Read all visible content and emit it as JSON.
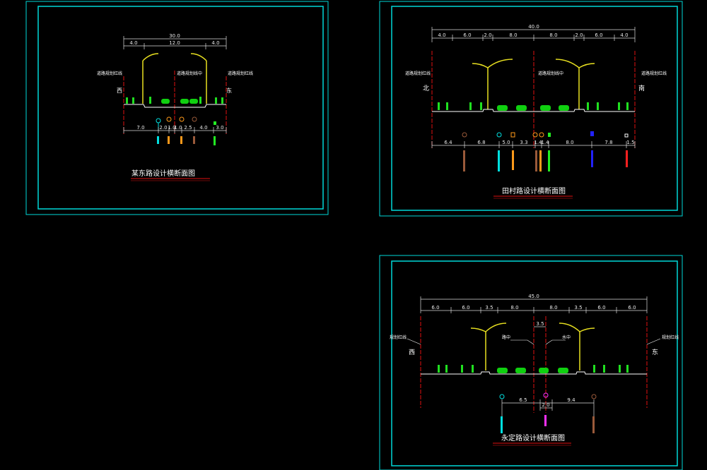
{
  "sheets": [
    {
      "title": "某东路设计横断面图",
      "top_total": "30.0",
      "top_dims": [
        "4.0",
        "12.0",
        "4.0"
      ],
      "left_label": "道路规划红线",
      "right_label": "道路规划红线",
      "center_label": "道路规划线中",
      "left_dir": "西",
      "right_dir": "东",
      "bottom_dims": [
        "7.0",
        "2.0",
        "1.0",
        "1.0",
        "2.5",
        "4.0",
        "3.0"
      ]
    },
    {
      "title": "田村路设计横断面图",
      "top_total": "40.0",
      "top_dims": [
        "4.0",
        "6.0",
        "2.0",
        "8.0",
        "8.0",
        "2.0",
        "6.0",
        "4.0"
      ],
      "left_label": "道路规划红线",
      "right_label": "道路规划红线",
      "center_label": "道路规划线中",
      "left_dir": "北",
      "right_dir": "南",
      "bottom_dims": [
        "6.4",
        "6.8",
        "5.0",
        "3.3",
        "1.4",
        "1.4",
        "8.0",
        "7.8",
        "1.5"
      ]
    },
    {
      "title": "永定路设计横断面图",
      "top_total": "45.0",
      "top_dims": [
        "6.0",
        "6.0",
        "3.5",
        "8.0",
        "8.0",
        "3.5",
        "6.0",
        "6.0"
      ],
      "median_dim": "3.5",
      "left_label": "规划红线",
      "right_label": "规划红线",
      "center_left_label": "路中",
      "center_right_label": "水中",
      "left_dir": "西",
      "right_dir": "东",
      "bottom_dims": [
        "6.5",
        "2.0",
        "9.4"
      ]
    }
  ],
  "colors": {
    "frame": "#00d8d8",
    "red_line": "#e01010",
    "tree": "#20e020",
    "lamp": "#e8e020",
    "car": "#10d010",
    "ground": "#ffffff",
    "pipe_cyan": "#00e0e0",
    "pipe_orange": "#ff9a1a",
    "pipe_brown": "#9a5a3a",
    "pipe_green": "#22ee22",
    "pipe_blue": "#2222ff",
    "pipe_red": "#ff2020",
    "pipe_magenta": "#ff30ff"
  },
  "icons": [
    "tree-icon",
    "street-lamp-icon",
    "car-icon",
    "pipe-marker-icon"
  ]
}
